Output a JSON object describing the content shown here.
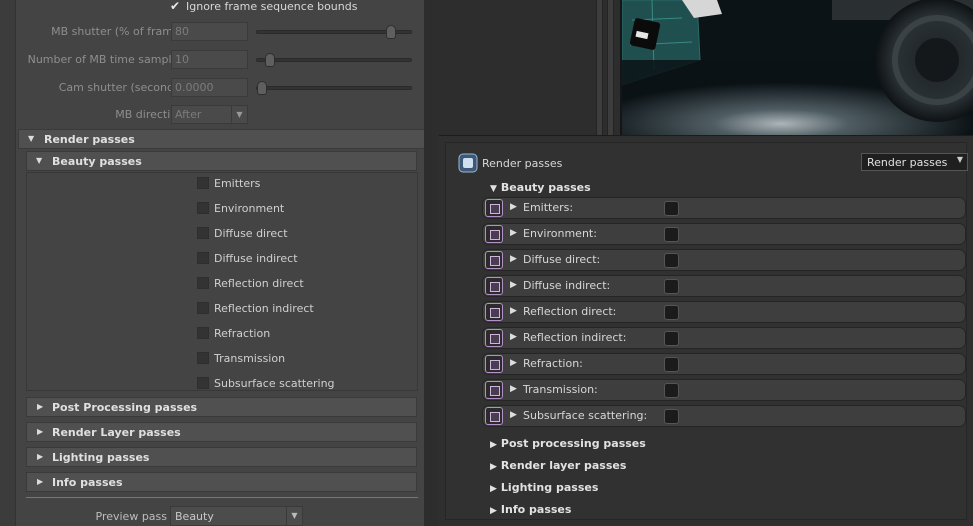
{
  "motion_blur": {
    "ignore_frame_sequence_bounds": {
      "label": "Ignore frame sequence bounds",
      "checked": true
    },
    "mb_shutter": {
      "label": "MB shutter (% of frame)",
      "value": "80",
      "slider_fraction": 0.8
    },
    "mb_time_samples": {
      "label": "Number of MB time samples",
      "value": "10",
      "slider_fraction": 0.06
    },
    "cam_shutter": {
      "label": "Cam shutter (seconds)",
      "value": "0.0000",
      "slider_fraction": 0.0
    },
    "mb_direction": {
      "label": "MB direction",
      "value": "After"
    }
  },
  "left_panel": {
    "render_passes_label": "Render passes",
    "beauty_passes_label": "Beauty passes",
    "beauty_items": [
      {
        "label": "Emitters",
        "checked": false
      },
      {
        "label": "Environment",
        "checked": false
      },
      {
        "label": "Diffuse direct",
        "checked": false
      },
      {
        "label": "Diffuse indirect",
        "checked": false
      },
      {
        "label": "Reflection direct",
        "checked": false
      },
      {
        "label": "Reflection indirect",
        "checked": false
      },
      {
        "label": "Refraction",
        "checked": false
      },
      {
        "label": "Transmission",
        "checked": false
      },
      {
        "label": "Subsurface scattering",
        "checked": false
      }
    ],
    "collapsed_sections": [
      "Post Processing passes",
      "Render Layer passes",
      "Lighting passes",
      "Info passes"
    ],
    "preview_pass": {
      "label": "Preview pass",
      "value": "Beauty"
    }
  },
  "right_panel": {
    "title": "Render passes",
    "dropdown_value": "Render passes",
    "beauty_group": "Beauty passes",
    "passes": [
      {
        "label": "Emitters:",
        "checked": false
      },
      {
        "label": "Environment:",
        "checked": false
      },
      {
        "label": "Diffuse direct:",
        "checked": false
      },
      {
        "label": "Diffuse indirect:",
        "checked": false
      },
      {
        "label": "Reflection direct:",
        "checked": false
      },
      {
        "label": "Reflection indirect:",
        "checked": false
      },
      {
        "label": "Refraction:",
        "checked": false
      },
      {
        "label": "Transmission:",
        "checked": false
      },
      {
        "label": "Subsurface scattering:",
        "checked": false
      }
    ],
    "collapsed_groups": [
      "Post processing passes",
      "Render layer passes",
      "Lighting passes",
      "Info passes"
    ]
  },
  "icons": {
    "check": "✔",
    "triangle_down": "▼",
    "triangle_right": "▶",
    "dropdown_arrow": "▼"
  },
  "colors": {
    "panel_bg": "#444444",
    "header_bg": "#505050",
    "pin_accent": "#b48fc8"
  }
}
